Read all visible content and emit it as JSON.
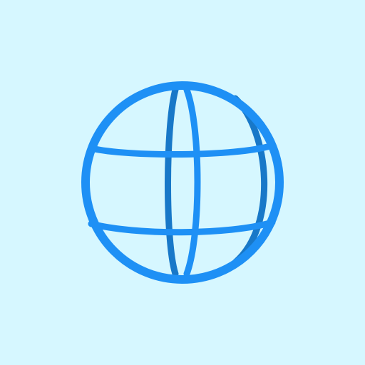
{
  "icon": {
    "name": "globe-icon"
  },
  "colors": {
    "background": "#D6F7FF",
    "primary_stroke": "#1E90F5",
    "secondary_stroke": "#1878C8"
  }
}
